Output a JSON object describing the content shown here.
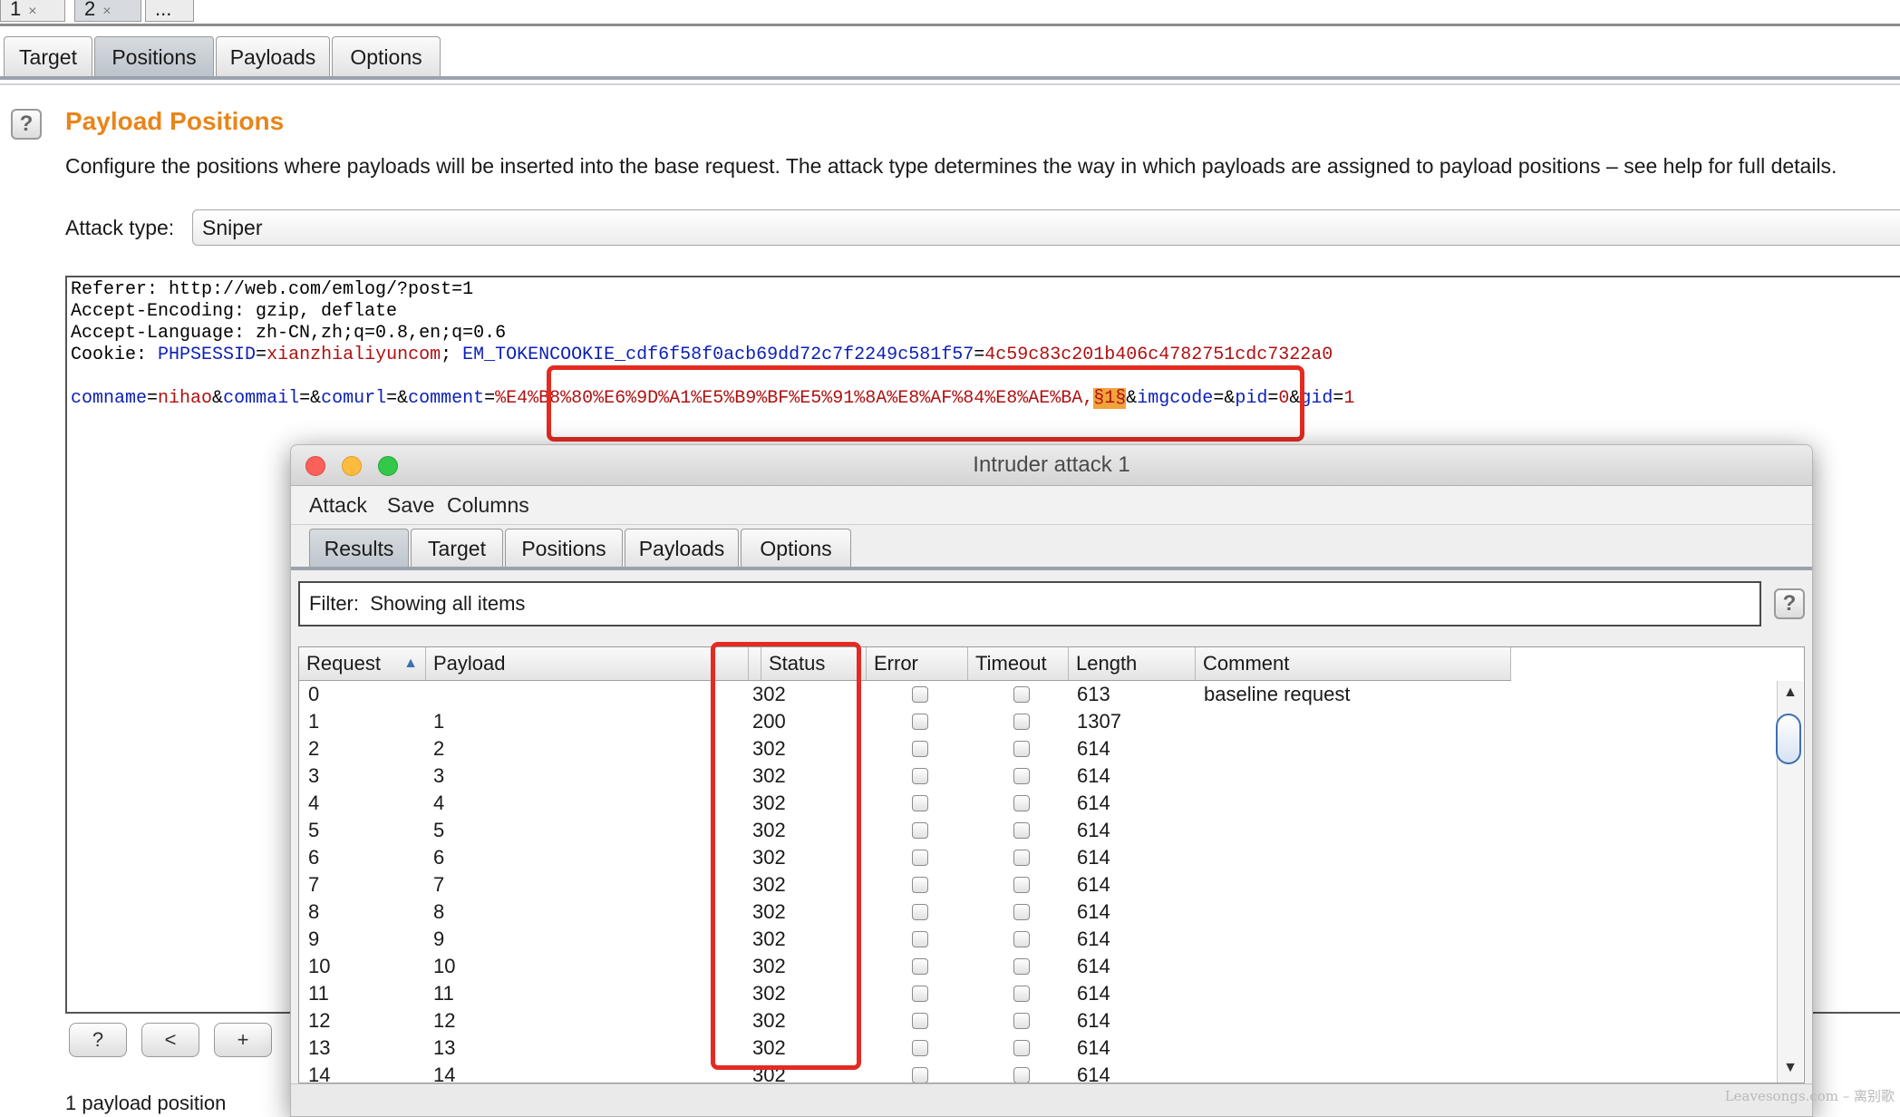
{
  "outer_tabs": [
    {
      "label": "1",
      "close": "×"
    },
    {
      "label": "2",
      "close": "×"
    },
    {
      "label": "..."
    }
  ],
  "main_tabs": [
    "Target",
    "Positions",
    "Payloads",
    "Options"
  ],
  "section": {
    "help_label": "?",
    "title": "Payload Positions",
    "description": "Configure the positions where payloads will be inserted into the base request. The attack type determines the way in which payloads are assigned to payload positions – see help for full details.",
    "attack_type_label": "Attack type:",
    "attack_type_value": "Sniper"
  },
  "request": {
    "referer_key": "Referer:",
    "referer_val": " http://web.com/emlog/?post=1",
    "enc_key": "Accept-Encoding:",
    "enc_val": " gzip, deflate",
    "lang_key": "Accept-Language:",
    "lang_val": " zh-CN,zh;q=0.8,en;q=0.6",
    "cookie_key": "Cookie: ",
    "c1_name": "PHPSESSID",
    "c1_eq": "=",
    "c1_val": "xianzhialiyuncom",
    "c1_sep": "; ",
    "c2_name": "EM_TOKENCOOKIE_cdf6f58f0acb69dd72c7f2249c581f57",
    "c2_eq": "=",
    "c2_val": "4c59c83c201b406c4782751cdc7322a0",
    "b_comname": "comname",
    "b_eq1": "=",
    "b_nihao": "nihao",
    "b_amp1": "&",
    "b_commail": "commail",
    "b_eq2": "=&",
    "b_comurl": "comurl",
    "b_eq3": "=&",
    "b_comment": "comment",
    "b_eq4": "=",
    "b_comment_val": "%E4%B8%80%E6%9D%A1%E5%B9%BF%E5%91%8A%E8%AF%84%E8%AE%BA,",
    "b_marker": "§1§",
    "b_amp5": "&",
    "b_imgcode": "imgcode",
    "b_eq5": "=&",
    "b_pid": "pid",
    "b_eq6": "=",
    "b_pid_val": "0",
    "b_amp6": "&",
    "b_gid": "gid",
    "b_eq7": "=",
    "b_gid_val": "1"
  },
  "editor_buttons": [
    "?",
    "<",
    "+"
  ],
  "footnote": "1 payload position",
  "attack_window": {
    "title": "Intruder attack 1",
    "menu": [
      "Attack",
      "Save",
      "Columns"
    ],
    "tabs": [
      "Results",
      "Target",
      "Positions",
      "Payloads",
      "Options"
    ],
    "filter_label": "Filter:",
    "filter_text": "Showing all items",
    "help_label": "?",
    "columns": [
      "Request",
      "Payload",
      "Status",
      "Error",
      "Timeout",
      "Length",
      "Comment"
    ],
    "sort_indicator": "▲",
    "rows": [
      {
        "request": "0",
        "payload": "",
        "status": "302",
        "length": "613",
        "comment": "baseline request"
      },
      {
        "request": "1",
        "payload": "1",
        "status": "200",
        "length": "1307",
        "comment": ""
      },
      {
        "request": "2",
        "payload": "2",
        "status": "302",
        "length": "614",
        "comment": ""
      },
      {
        "request": "3",
        "payload": "3",
        "status": "302",
        "length": "614",
        "comment": ""
      },
      {
        "request": "4",
        "payload": "4",
        "status": "302",
        "length": "614",
        "comment": ""
      },
      {
        "request": "5",
        "payload": "5",
        "status": "302",
        "length": "614",
        "comment": ""
      },
      {
        "request": "6",
        "payload": "6",
        "status": "302",
        "length": "614",
        "comment": ""
      },
      {
        "request": "7",
        "payload": "7",
        "status": "302",
        "length": "614",
        "comment": ""
      },
      {
        "request": "8",
        "payload": "8",
        "status": "302",
        "length": "614",
        "comment": ""
      },
      {
        "request": "9",
        "payload": "9",
        "status": "302",
        "length": "614",
        "comment": ""
      },
      {
        "request": "10",
        "payload": "10",
        "status": "302",
        "length": "614",
        "comment": ""
      },
      {
        "request": "11",
        "payload": "11",
        "status": "302",
        "length": "614",
        "comment": ""
      },
      {
        "request": "12",
        "payload": "12",
        "status": "302",
        "length": "614",
        "comment": ""
      },
      {
        "request": "13",
        "payload": "13",
        "status": "302",
        "length": "614",
        "comment": ""
      },
      {
        "request": "14",
        "payload": "14",
        "status": "302",
        "length": "614",
        "comment": ""
      }
    ],
    "scroll_up": "▲",
    "scroll_down": "▼"
  },
  "watermark": "Leavesongs.com – 离别歌",
  "colors": {
    "title_orange": "#e8851a",
    "highlight_red": "#e32b22",
    "key_blue": "#0b1fb5",
    "value_red": "#b01010",
    "marker_orange": "#f1a33c"
  }
}
